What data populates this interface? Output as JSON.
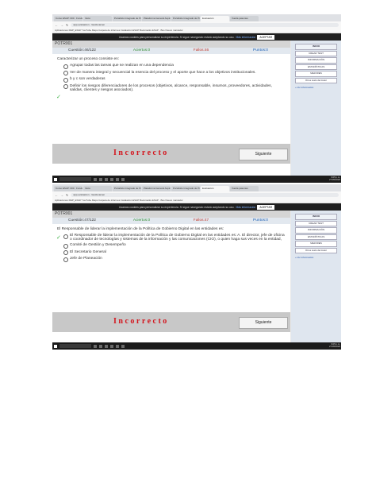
{
  "screens": [
    {
      "tabs": [
        "Curso ESAP: 000 · Fundamentos",
        "Inicio",
        "Portafolio Integrado de Proyectos",
        "Plataforma General Aspiranto",
        "Portafolio Integrado de Proyectos",
        "Evaluación",
        "Vuelta patentes"
      ],
      "url": "app.evaluacion.../test/examen",
      "bookmarks": "Aplicaciones   REP_ESAP   YouTube   Maps   Carpeta de informes   Instalación ESAP   Bookmarks ESAP · Bus   Nuevo marcador",
      "cookie": {
        "text": "Usamos cookies para personalizar su experiencia. Si sigue navegando estará aceptando su uso.",
        "more": "Más información",
        "accept": "ACEPTAR"
      },
      "title": "POTR001",
      "stats": {
        "question": "Cuestión:46/122",
        "correct": "Aciertos:0",
        "wrong": "Fallos:46",
        "points": "Puntos:0"
      },
      "question": "Caracterizar un proceso consiste en:",
      "options": [
        "Agrupar todas las tareas que se realizan en una dependencia",
        "Ver de manera integral y secuencial la esencia del proceso y el aporte que hace a los objetivos institucionales.",
        "b y c son verdaderas",
        "Definir los riesgos diferenciadores de los procesos (objetivos, alcance, responsable, insumos, proveedores, actividades, salidas, clientes y riesgos asociados)."
      ],
      "result": "Incorrecto",
      "next": "Siguiente",
      "sidebar": [
        "INICIO",
        "CREAR TEST",
        "INFORMACIÓN",
        "ESTADÍSTICAS",
        "MEJORES",
        "Otros tests del Autor"
      ],
      "sidebar_link": "» Ver información",
      "clock": {
        "time": "9:05 p.m.",
        "date": "27/05/2020"
      }
    },
    {
      "tabs": [
        "Curso ESAP: 000 · Fundamentos",
        "Inicio",
        "Portafolio Integrado de Proyectos",
        "Plataforma General Aspiranto",
        "Portafolio Integrado de Proyectos",
        "Evaluación",
        "Vuelta patentes"
      ],
      "url": "app.evaluacion.../test/examen",
      "bookmarks": "Aplicaciones   REP_ESAP   YouTube   Maps   Carpeta de informes   Instalación ESAP   Bookmarks ESAP · Bus   Nuevo marcador",
      "cookie": {
        "text": "Usamos cookies para personalizar su experiencia. Si sigue navegando estará aceptando su uso.",
        "more": "Más información",
        "accept": "ACEPTAR"
      },
      "title": "POTR001",
      "stats": {
        "question": "Cuestión:47/122",
        "correct": "Aciertos:0",
        "wrong": "Fallos:47",
        "points": "Puntos:0"
      },
      "question": "El Responsable de liderar la implementación de la Política de Gobierno Digital en las entidades es:",
      "options": [
        "El Responsable de liderar la implementación de la Política de Gobierno Digital en las entidades es: A. El director, jefe de oficina o coordinador de tecnologías y sistemas de la información y las comunicaciones (CIO), o quien haga sus veces en la entidad,",
        "Comité de Gestión y Desempeño",
        "El Secretario General",
        "Jefe de Planeación"
      ],
      "result": "Incorrecto",
      "next": "Siguiente",
      "sidebar": [
        "INICIO",
        "CREAR TEST",
        "INFORMACIÓN",
        "ESTADÍSTICAS",
        "MEJORES",
        "Otros tests del Autor"
      ],
      "sidebar_link": "» Ver información",
      "clock": {
        "time": "9:05 p.m.",
        "date": "27/05/2020"
      }
    }
  ]
}
